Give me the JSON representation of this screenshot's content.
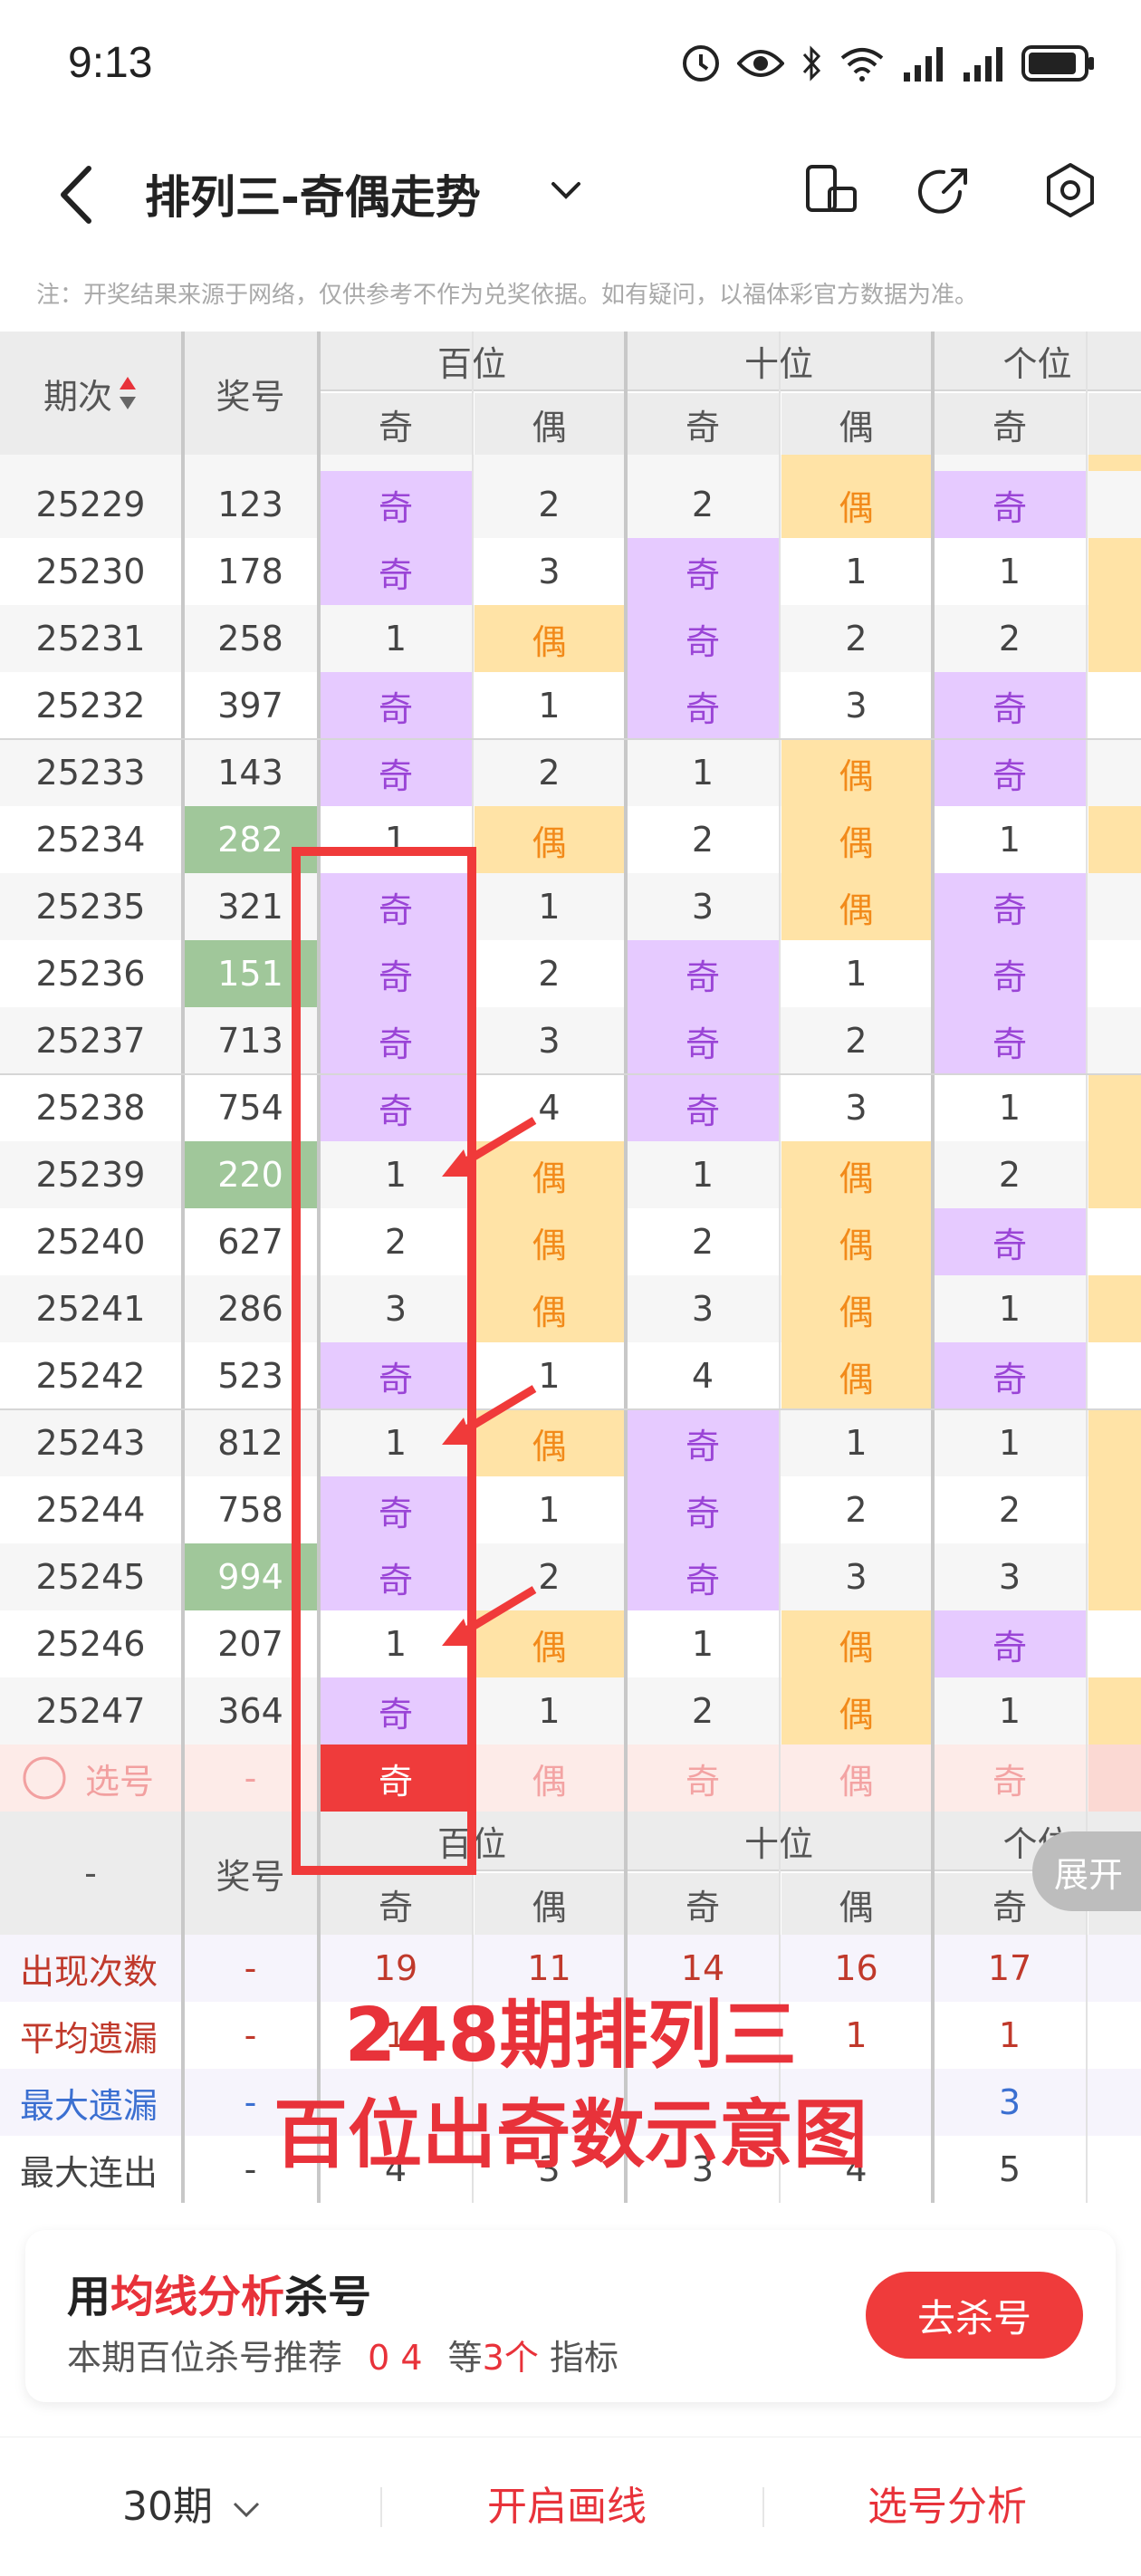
{
  "status_bar": {
    "time": "9:13"
  },
  "navbar": {
    "title": "排列三-奇偶走势"
  },
  "notice": "注：开奖结果来源于网络，仅供参考不作为兑奖依据。如有疑问，以福体彩官方数据为准。",
  "table": {
    "col_period": "期次",
    "col_number": "奖号",
    "groups": [
      "百位",
      "十位",
      "个位"
    ],
    "sub": {
      "odd": "奇",
      "even": "偶"
    },
    "rows": [
      {
        "period": "25229",
        "number": "123",
        "hl": false,
        "b": [
          "奇",
          "2"
        ],
        "s": [
          "2",
          "偶"
        ],
        "g": [
          "奇"
        ]
      },
      {
        "period": "25230",
        "number": "178",
        "hl": false,
        "b": [
          "奇",
          "3"
        ],
        "s": [
          "奇",
          "1"
        ],
        "g": [
          "1"
        ]
      },
      {
        "period": "25231",
        "number": "258",
        "hl": false,
        "b": [
          "1",
          "偶"
        ],
        "s": [
          "奇",
          "2"
        ],
        "g": [
          "2"
        ]
      },
      {
        "period": "25232",
        "number": "397",
        "hl": false,
        "b": [
          "奇",
          "1"
        ],
        "s": [
          "奇",
          "3"
        ],
        "g": [
          "奇"
        ]
      },
      {
        "period": "25233",
        "number": "143",
        "hl": false,
        "b": [
          "奇",
          "2"
        ],
        "s": [
          "1",
          "偶"
        ],
        "g": [
          "奇"
        ]
      },
      {
        "period": "25234",
        "number": "282",
        "hl": true,
        "b": [
          "1",
          "偶"
        ],
        "s": [
          "2",
          "偶"
        ],
        "g": [
          "1"
        ]
      },
      {
        "period": "25235",
        "number": "321",
        "hl": false,
        "b": [
          "奇",
          "1"
        ],
        "s": [
          "3",
          "偶"
        ],
        "g": [
          "奇"
        ]
      },
      {
        "period": "25236",
        "number": "151",
        "hl": true,
        "b": [
          "奇",
          "2"
        ],
        "s": [
          "奇",
          "1"
        ],
        "g": [
          "奇"
        ]
      },
      {
        "period": "25237",
        "number": "713",
        "hl": false,
        "b": [
          "奇",
          "3"
        ],
        "s": [
          "奇",
          "2"
        ],
        "g": [
          "奇"
        ]
      },
      {
        "period": "25238",
        "number": "754",
        "hl": false,
        "b": [
          "奇",
          "4"
        ],
        "s": [
          "奇",
          "3"
        ],
        "g": [
          "1"
        ]
      },
      {
        "period": "25239",
        "number": "220",
        "hl": true,
        "b": [
          "1",
          "偶"
        ],
        "s": [
          "1",
          "偶"
        ],
        "g": [
          "2"
        ]
      },
      {
        "period": "25240",
        "number": "627",
        "hl": false,
        "b": [
          "2",
          "偶"
        ],
        "s": [
          "2",
          "偶"
        ],
        "g": [
          "奇"
        ]
      },
      {
        "period": "25241",
        "number": "286",
        "hl": false,
        "b": [
          "3",
          "偶"
        ],
        "s": [
          "3",
          "偶"
        ],
        "g": [
          "1"
        ]
      },
      {
        "period": "25242",
        "number": "523",
        "hl": false,
        "b": [
          "奇",
          "1"
        ],
        "s": [
          "4",
          "偶"
        ],
        "g": [
          "奇"
        ]
      },
      {
        "period": "25243",
        "number": "812",
        "hl": false,
        "b": [
          "1",
          "偶"
        ],
        "s": [
          "奇",
          "1"
        ],
        "g": [
          "1"
        ]
      },
      {
        "period": "25244",
        "number": "758",
        "hl": false,
        "b": [
          "奇",
          "1"
        ],
        "s": [
          "奇",
          "2"
        ],
        "g": [
          "2"
        ]
      },
      {
        "period": "25245",
        "number": "994",
        "hl": true,
        "b": [
          "奇",
          "2"
        ],
        "s": [
          "奇",
          "3"
        ],
        "g": [
          "3"
        ]
      },
      {
        "period": "25246",
        "number": "207",
        "hl": false,
        "b": [
          "1",
          "偶"
        ],
        "s": [
          "1",
          "偶"
        ],
        "g": [
          "奇"
        ]
      },
      {
        "period": "25247",
        "number": "364",
        "hl": false,
        "b": [
          "奇",
          "1"
        ],
        "s": [
          "2",
          "偶"
        ],
        "g": [
          "1"
        ]
      }
    ],
    "select_row": {
      "label": "选号",
      "number": "-",
      "cells": [
        "奇",
        "偶",
        "奇",
        "偶",
        "奇"
      ]
    }
  },
  "stats": {
    "header_left": "-",
    "header_number": "奖号",
    "rows": [
      {
        "label": "出现次数",
        "dash": "-",
        "values": [
          "19",
          "11",
          "14",
          "16",
          "17"
        ],
        "color": "#c0392b"
      },
      {
        "label": "平均遗漏",
        "dash": "-",
        "values": [
          "1",
          "",
          "",
          "1",
          "1"
        ],
        "color": "#c0392b"
      },
      {
        "label": "最大遗漏",
        "dash": "-",
        "values": [
          "",
          "",
          "",
          "",
          "3"
        ],
        "color": "#3b6fd1"
      },
      {
        "label": "最大连出",
        "dash": "-",
        "values": [
          "4",
          "3",
          "3",
          "4",
          "5"
        ],
        "color": "#444444"
      }
    ]
  },
  "annotation": {
    "line1": "248期排列三",
    "line2": "百位出奇数示意图"
  },
  "expand_label": "展开",
  "card": {
    "title_pre": "用",
    "title_red": "均线分析",
    "title_post": "杀号",
    "sub_pre": "本期百位杀号推荐",
    "sub_nums": "0 4",
    "sub_mid": "等",
    "sub_count": "3个",
    "sub_post": "指标",
    "button": "去杀号"
  },
  "bottom": {
    "periods": "30期",
    "draw": "开启画线",
    "analysis": "选号分析"
  },
  "colors": {
    "accent": "#e8323a",
    "odd_bg": "#e6caff",
    "even_bg": "#ffe3a6",
    "highlight": "#a0c79a"
  }
}
